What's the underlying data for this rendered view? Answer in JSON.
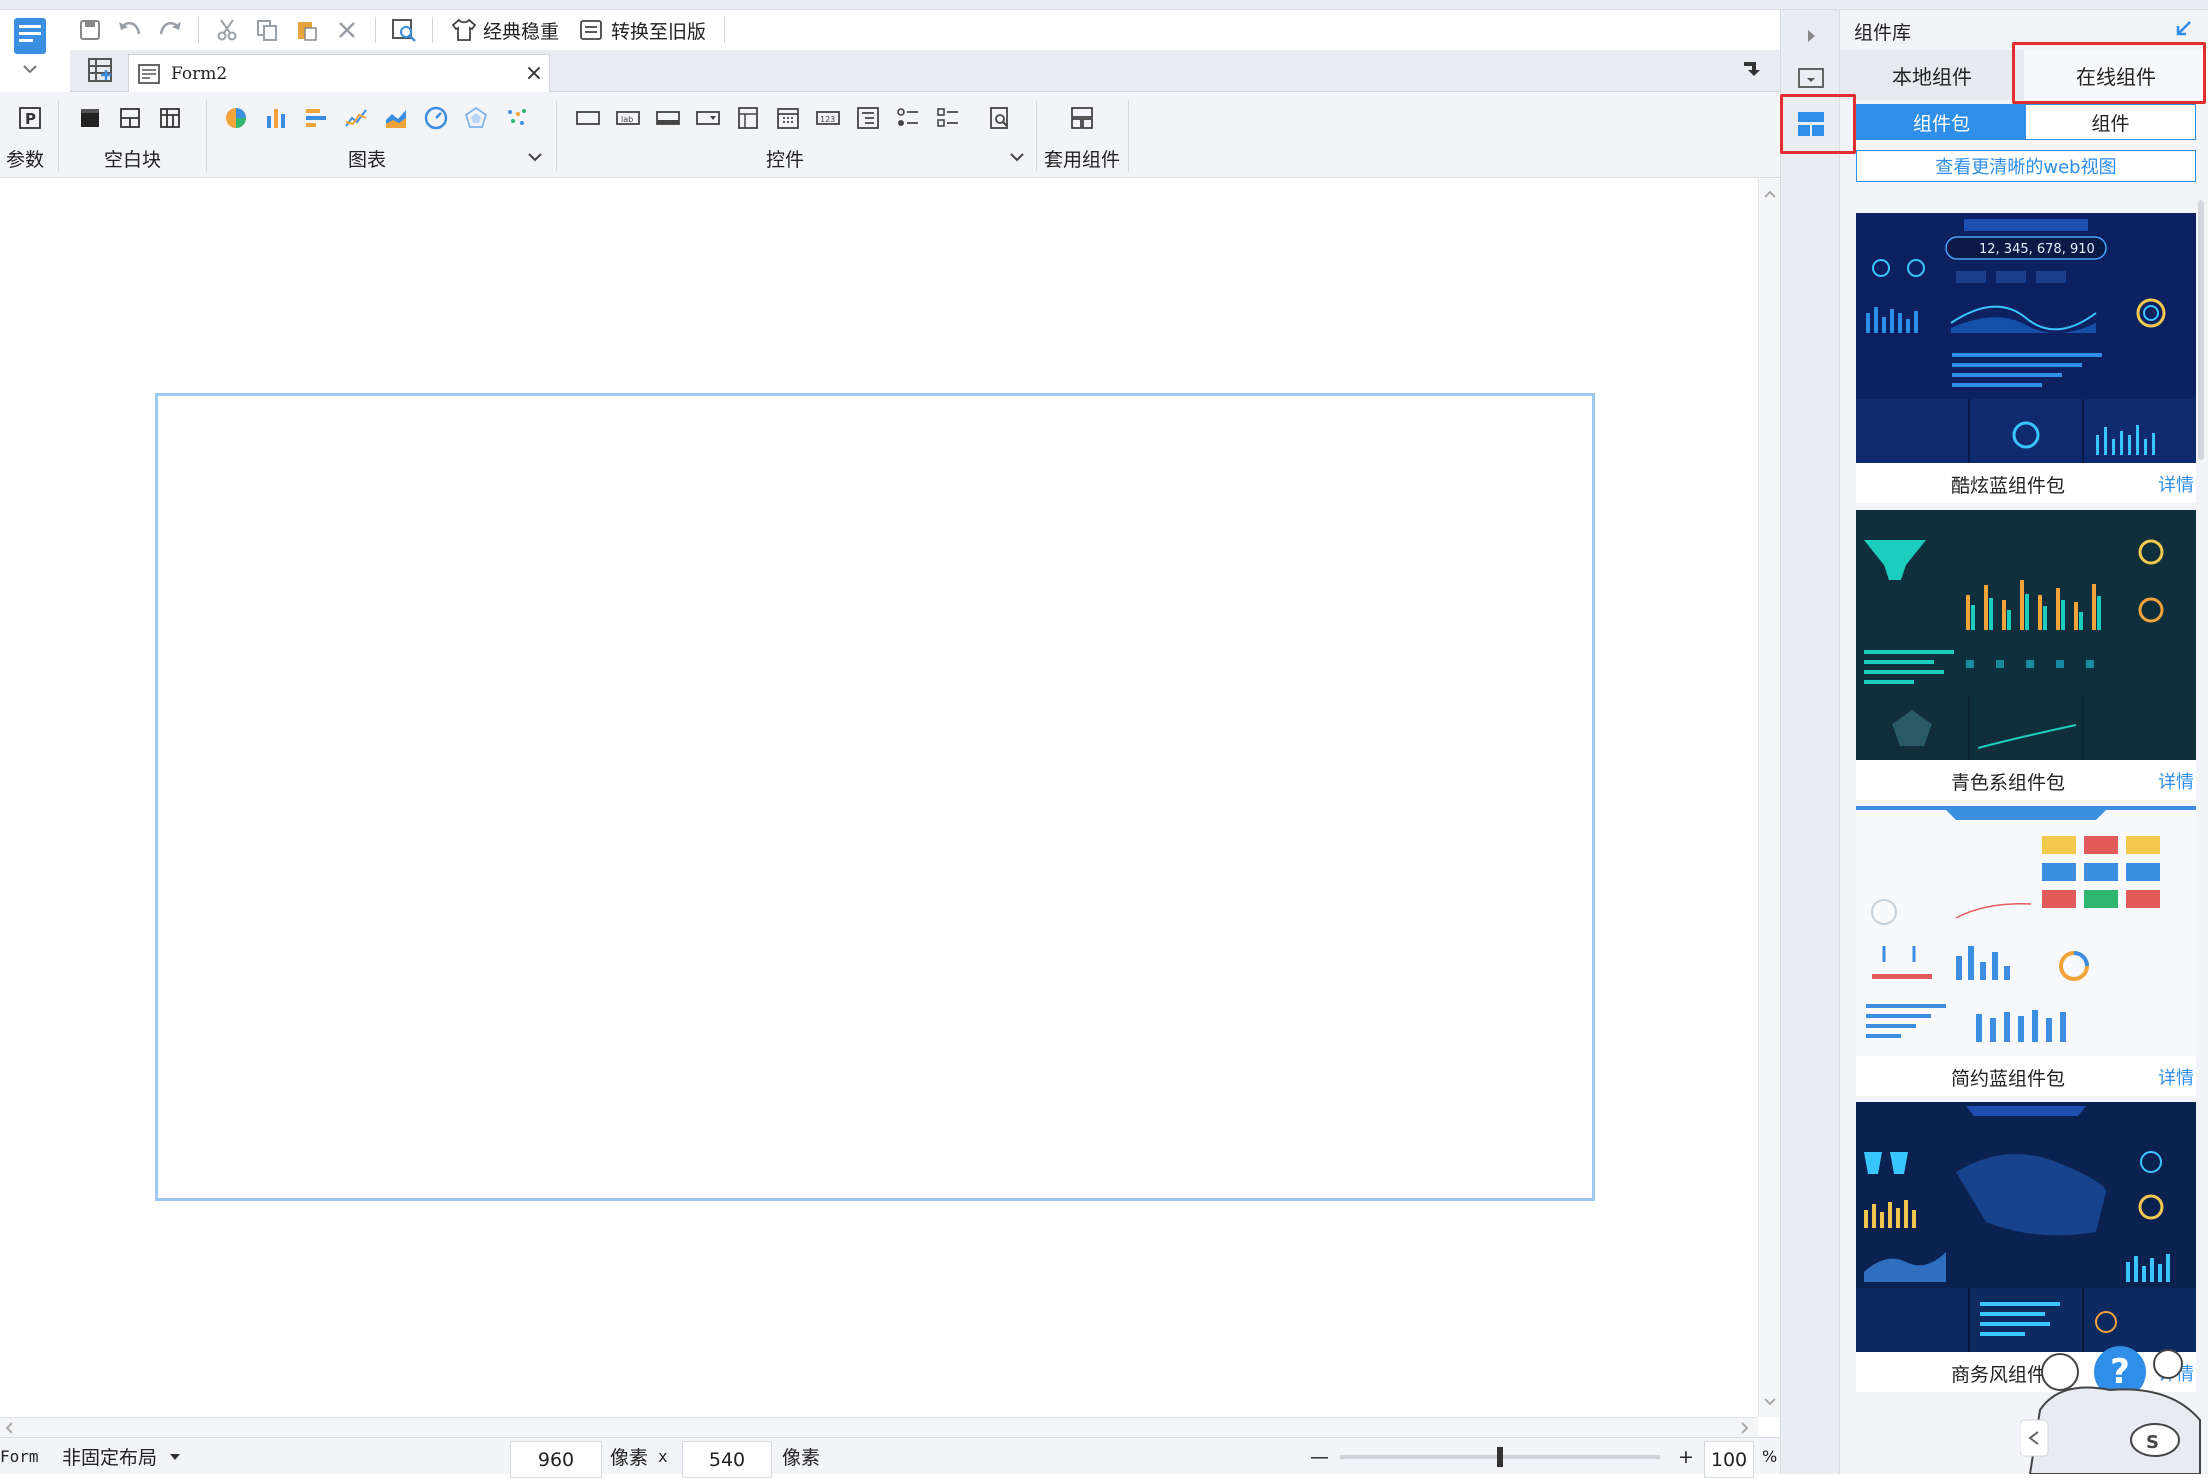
{
  "toolbar": {
    "classic_theme": "经典稳重",
    "convert_old": "转换至旧版"
  },
  "tab": {
    "label": "Form2",
    "close": "×"
  },
  "ribbon": {
    "param_label": "参数",
    "blank_label": "空白块",
    "chart_label": "图表",
    "widget_label": "控件",
    "template_label": "套用组件"
  },
  "statusbar": {
    "form_label": "Form",
    "layout_label": "非固定布局",
    "width_value": "960",
    "unit1": "像素",
    "times": "x",
    "height_value": "540",
    "unit2": "像素",
    "zoom_minus": "—",
    "zoom_plus": "+",
    "zoom_value": "100",
    "zoom_unit": "%",
    "zoom_fraction": 0.5
  },
  "panel": {
    "title": "组件库",
    "tabs": [
      {
        "label": "本地组件"
      },
      {
        "label": "在线组件"
      }
    ],
    "subtabs": [
      {
        "label": "组件包",
        "active": true
      },
      {
        "label": "组件",
        "active": false
      }
    ],
    "web_view_link": "查看更清晰的web视图",
    "packages": [
      {
        "name": "酷炫蓝组件包",
        "detail": "详情",
        "theme": "dark-blue"
      },
      {
        "name": "青色系组件包",
        "detail": "详情",
        "theme": "dark-cyan"
      },
      {
        "name": "简约蓝组件包",
        "detail": "详情",
        "theme": "light-blue"
      },
      {
        "name": "商务风组件包",
        "detail": "详情",
        "theme": "dark-business"
      }
    ]
  },
  "thumb_texts": {
    "big_number": "12, 345, 678, 910"
  },
  "help": {
    "label": "?"
  },
  "colors": {
    "accent": "#2e8ee8",
    "highlight": "#e52d2d",
    "frame": "#9fc8ee",
    "dark_bg": "#0b1a3c"
  }
}
